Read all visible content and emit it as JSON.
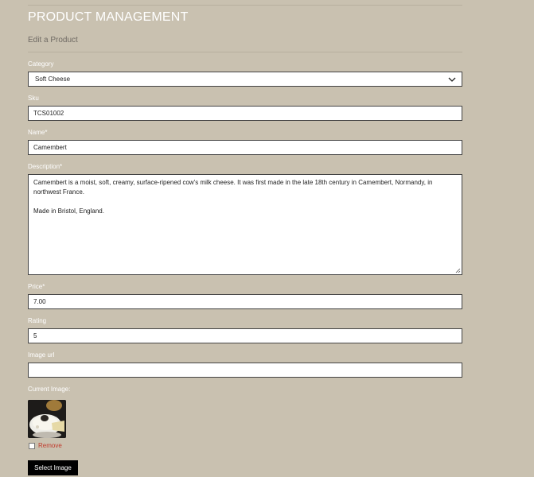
{
  "header": {
    "title": "PRODUCT MANAGEMENT",
    "subtitle": "Edit a Product"
  },
  "form": {
    "category": {
      "label": "Category",
      "value": "Soft Cheese"
    },
    "sku": {
      "label": "Sku",
      "value": "TCS01002"
    },
    "name": {
      "label": "Name*",
      "value": "Camembert"
    },
    "description": {
      "label": "Description*",
      "paragraphs": [
        "Camembert is a moist, soft, creamy, surface-ripened cow's milk cheese. It was first made in the late 18th century in Camembert, Normandy, in northwest France.",
        "Made in Bristol, England."
      ]
    },
    "price": {
      "label": "Price*",
      "value": "7.00"
    },
    "rating": {
      "label": "Rating",
      "value": "5"
    },
    "image_url": {
      "label": "Image url",
      "value": ""
    },
    "current_image": {
      "label": "Current Image:",
      "remove_label": "Remove",
      "remove_checked": false
    },
    "select_image_button": "Select Image"
  },
  "colors": {
    "background": "#c9c1b0",
    "remove_text": "#c0392b",
    "button_bg": "#000000"
  },
  "icons": {
    "select_arrow": "chevron-down-icon",
    "textarea_resize": "resize-grip-icon",
    "thumbnail": "camembert-thumbnail-image"
  }
}
